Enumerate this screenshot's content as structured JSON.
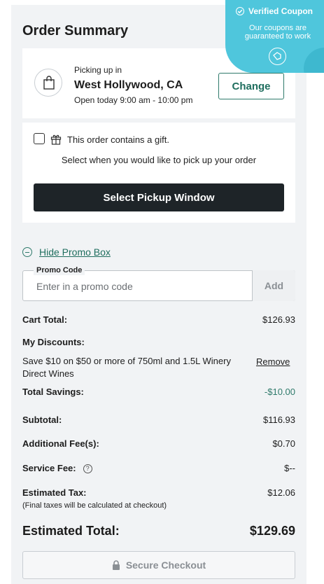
{
  "summary": {
    "title": "Order Summary"
  },
  "pickup": {
    "label": "Picking up in",
    "city": "West Hollywood, CA",
    "hours": "Open today 9:00 am - 10:00 pm",
    "change_label": "Change"
  },
  "gift": {
    "checkbox_label": "This order contains a gift.",
    "select_prompt": "Select when you would like to pick up your order",
    "select_button": "Select Pickup Window"
  },
  "promo": {
    "toggle_label": "Hide Promo Box",
    "field_label": "Promo Code",
    "placeholder": "Enter in a promo code",
    "add_label": "Add"
  },
  "totals": {
    "cart_total_label": "Cart Total:",
    "cart_total_value": "$126.93",
    "discounts_label": "My Discounts:",
    "discount_text": "Save $10 on $50 or more of 750ml and 1.5L Winery Direct Wines",
    "remove_label": "Remove",
    "savings_label": "Total Savings:",
    "savings_value": "-$10.00",
    "subtotal_label": "Subtotal:",
    "subtotal_value": "$116.93",
    "additional_fee_label": "Additional Fee(s):",
    "additional_fee_value": "$0.70",
    "service_fee_label": "Service Fee:",
    "service_fee_value": "$--",
    "tax_label": "Estimated Tax:",
    "tax_value": "$12.06",
    "tax_note": "(Final taxes will be calculated at checkout)",
    "estimated_total_label": "Estimated Total:",
    "estimated_total_value": "$129.69"
  },
  "checkout": {
    "label": "Secure Checkout"
  },
  "coupon_badge": {
    "title": "Verified Coupon",
    "line1": "Our coupons are",
    "line2": "guaranteed to work"
  },
  "colors": {
    "accent": "#2f7a6b",
    "badge": "#4fc6dc",
    "dark_button": "#1e2428"
  }
}
